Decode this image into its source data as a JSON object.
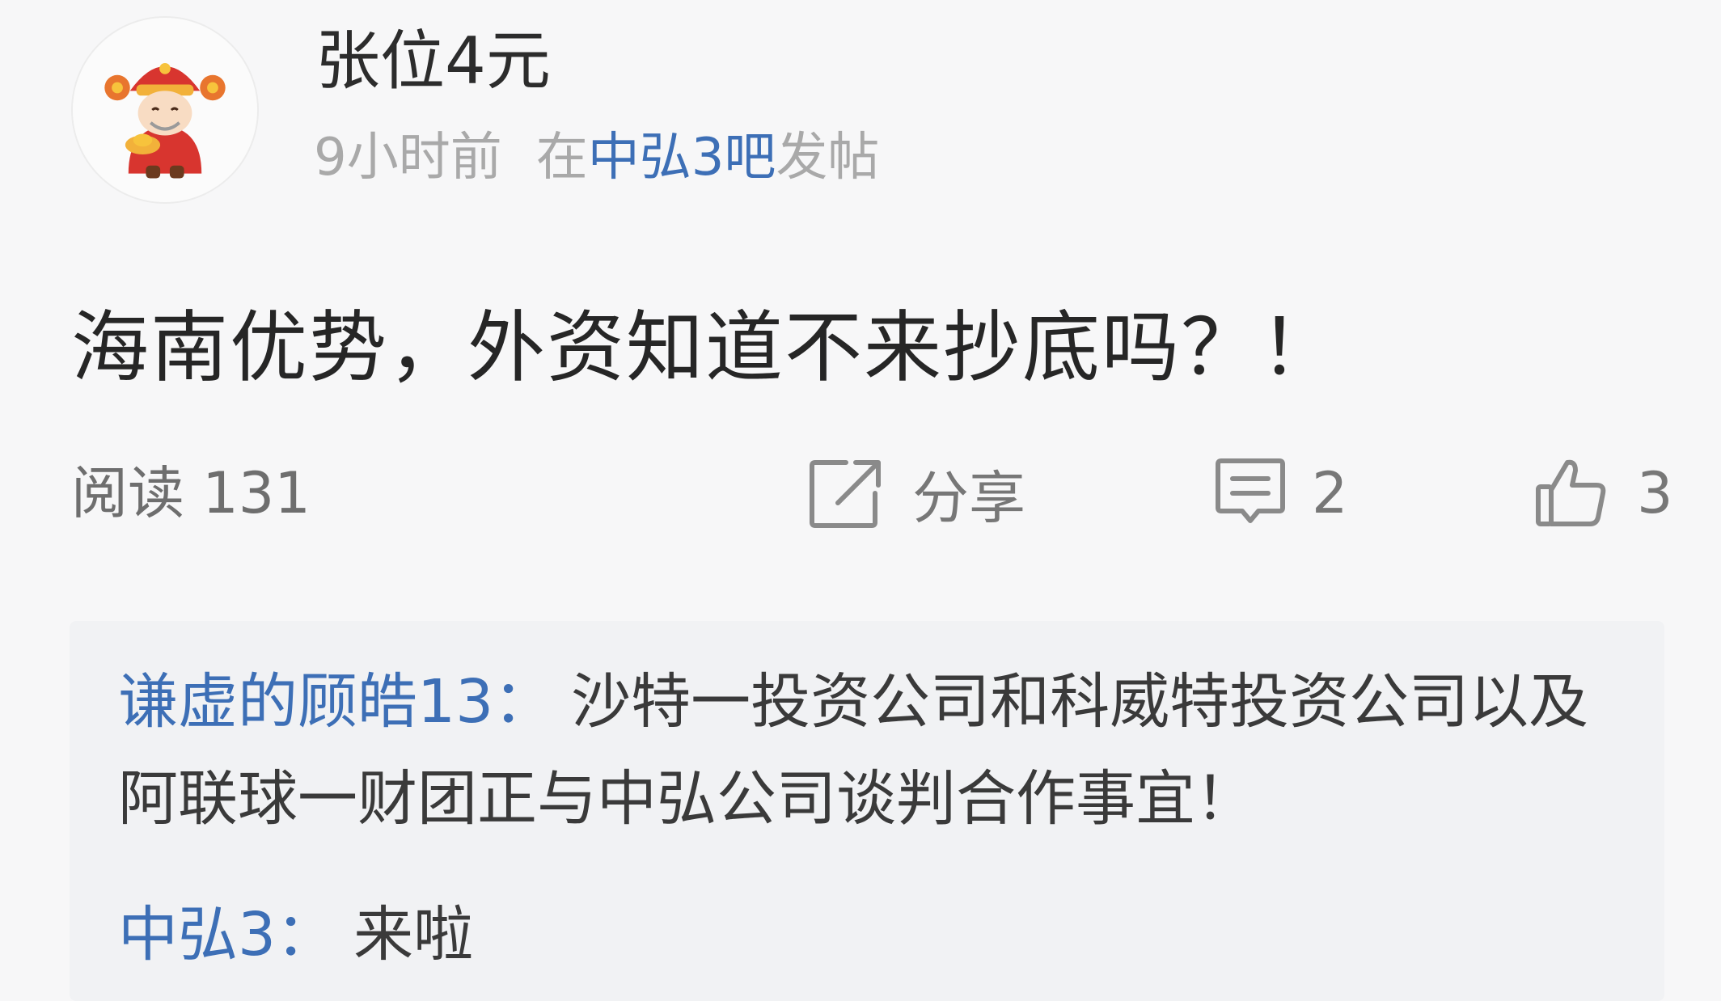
{
  "post": {
    "author": "张位4元",
    "time": "9小时前",
    "meta_prefix": "在",
    "forum": "中弘3吧",
    "meta_suffix": "发帖",
    "title": "海南优势，外资知道不来抄底吗？！"
  },
  "stats": {
    "reads": "阅读 131",
    "share_label": "分享",
    "comment_count": "2",
    "like_count": "3"
  },
  "replies": [
    {
      "author": "谦虚的顾皓13",
      "colon": "：",
      "text": "沙特一投资公司和科威特投资公司以及阿联球一财团正与中弘公司谈判合作事宜！"
    },
    {
      "author": "中弘3",
      "colon": "：",
      "text": "来啦"
    }
  ],
  "icons": {
    "avatar": "caishen-avatar",
    "share": "share-icon",
    "comment": "comment-icon",
    "like": "thumbs-up-icon"
  },
  "colors": {
    "link": "#3d6fb6",
    "muted": "#a9a9a9",
    "background": "#f7f7f8",
    "reply_background": "#f1f2f4"
  }
}
